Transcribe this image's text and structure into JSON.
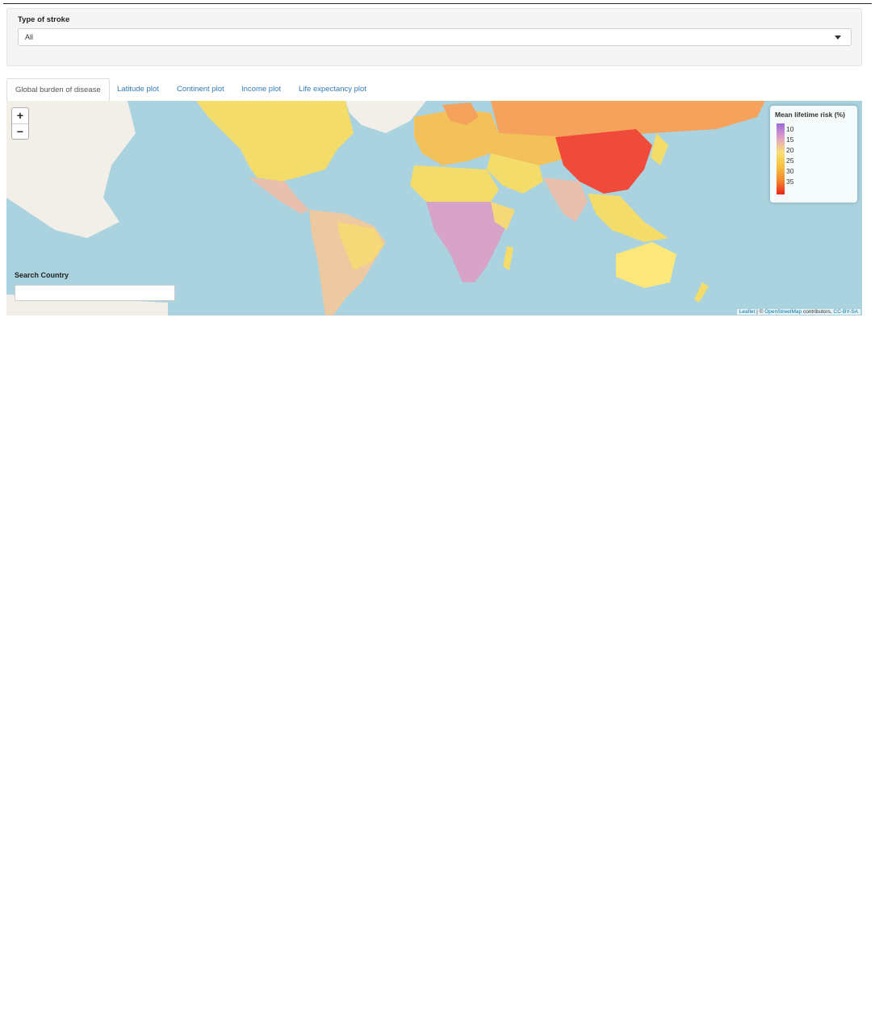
{
  "filter": {
    "label": "Type of stroke",
    "selected": "All"
  },
  "tabs": [
    {
      "label": "Global burden of disease",
      "active": true
    },
    {
      "label": "Latitude plot",
      "active": false
    },
    {
      "label": "Continent plot",
      "active": false
    },
    {
      "label": "Income plot",
      "active": false
    },
    {
      "label": "Life expectancy plot",
      "active": false
    }
  ],
  "map": {
    "zoom_in": "+",
    "zoom_out": "−",
    "legend": {
      "title": "Mean lifetime risk (%)",
      "ticks": [
        "10",
        "15",
        "20",
        "25",
        "30",
        "35"
      ],
      "colors": [
        "#9b6bd6",
        "#e0a0c8",
        "#f7e07a",
        "#f6c240",
        "#f38a2c",
        "#e8231b"
      ]
    },
    "search": {
      "label": "Search Country",
      "value": ""
    },
    "attribution": {
      "leaflet": "Leaflet",
      "sep": " | © ",
      "osm": "OpenStreetMap",
      "rest": " contributors, ",
      "license": "CC-BY-SA"
    }
  },
  "colors": {
    "ocean": "#aad3df",
    "land_base": "#f2efe9",
    "link": "#337ab7"
  }
}
